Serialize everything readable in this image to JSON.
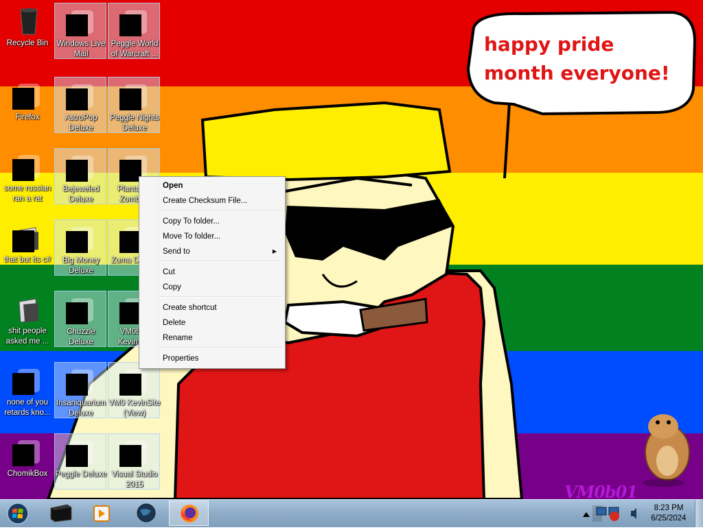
{
  "wallpaper": {
    "stripes": [
      "#e50000",
      "#ff8d00",
      "#ffee00",
      "#028121",
      "#004cff",
      "#770088"
    ],
    "bubble_text": "happy pride month everyone!",
    "signature": "VM0b01"
  },
  "desktop_icons": [
    {
      "label": "Recycle Bin",
      "icon": "recycle-bin-icon",
      "redacted": false
    },
    {
      "label": "Windows Live Mail",
      "icon": "mail-icon",
      "redacted": true
    },
    {
      "label": "Peggle World of Warcraft ...",
      "icon": "peggle-icon",
      "redacted": true
    },
    {
      "label": "Firefox",
      "icon": "firefox-icon",
      "redacted": true
    },
    {
      "label": "AstroPop Deluxe",
      "icon": "astropop-icon",
      "redacted": true
    },
    {
      "label": "Peggle Nights Deluxe",
      "icon": "peggle-nights-icon",
      "redacted": true
    },
    {
      "label": "some russian ran a rat",
      "icon": "file-icon",
      "redacted": true
    },
    {
      "label": "Bejeweled Deluxe",
      "icon": "bejeweled-icon",
      "redacted": true
    },
    {
      "label": "Plants vs. Zombies",
      "icon": "plants-icon",
      "redacted": true
    },
    {
      "label": "that but its c#",
      "icon": "folder-icon",
      "redacted": true
    },
    {
      "label": "Big Money Deluxe",
      "icon": "money-icon",
      "redacted": true
    },
    {
      "label": "Zuma Deluxe",
      "icon": "zuma-icon",
      "redacted": true
    },
    {
      "label": "shit people asked me ...",
      "icon": "folder-icon",
      "redacted": false
    },
    {
      "label": "Chuzzle Deluxe",
      "icon": "chuzzle-icon",
      "redacted": true
    },
    {
      "label": "VM0b01 KevinSite",
      "icon": "site-icon",
      "redacted": true
    },
    {
      "label": "none of you retards kno...",
      "icon": "app-icon",
      "redacted": true
    },
    {
      "label": "Insaniquarium Deluxe",
      "icon": "fish-icon",
      "redacted": true
    },
    {
      "label": "VM0 KevinSite (View)",
      "icon": "site-icon",
      "redacted": true
    },
    {
      "label": "ChomikBox",
      "icon": "hamster-icon",
      "redacted": true
    },
    {
      "label": "Peggle Deluxe",
      "icon": "peggle-icon",
      "redacted": true
    },
    {
      "label": "Visual Studio 2015",
      "icon": "visual-studio-icon",
      "redacted": true
    }
  ],
  "context_menu": {
    "items": [
      "Open",
      "Create Checksum File...",
      "Copy To folder...",
      "Move To folder...",
      "Send to",
      "Cut",
      "Copy",
      "Create shortcut",
      "Delete",
      "Rename",
      "Properties"
    ],
    "default_item": "Open",
    "submenu_item": "Send to"
  },
  "taskbar": {
    "pinned": [
      "command-prompt-icon",
      "media-player-icon",
      "globe-icon",
      "firefox-icon"
    ],
    "active": "firefox-icon",
    "tray_icons": [
      "show-hidden-icons-icon",
      "network-icon",
      "volume-icon"
    ],
    "time": "8:23 PM",
    "date": "6/25/2024"
  }
}
